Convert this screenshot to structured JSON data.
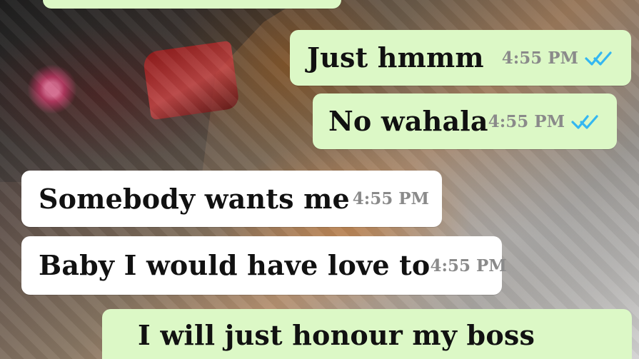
{
  "chat": {
    "messages": [
      {
        "text": "",
        "time": "",
        "direction": "out",
        "ticks": ""
      },
      {
        "text": "Just hmmm",
        "time": "4:55 PM",
        "direction": "out",
        "ticks": "double-check-icon"
      },
      {
        "text": "No wahala",
        "time": "4:55 PM",
        "direction": "out",
        "ticks": "double-check-icon"
      },
      {
        "text": "Somebody wants me",
        "time": "4:55 PM",
        "direction": "in"
      },
      {
        "text": "Baby I would have love to",
        "time": "4:55 PM",
        "direction": "in"
      },
      {
        "text": "I will just honour my boss",
        "time": "",
        "direction": "out"
      }
    ]
  },
  "colors": {
    "outgoing_bubble": "#dcf8c6",
    "incoming_bubble": "#ffffff",
    "tick_blue": "#34b7f1",
    "time_gray": "#8a8a8a"
  }
}
